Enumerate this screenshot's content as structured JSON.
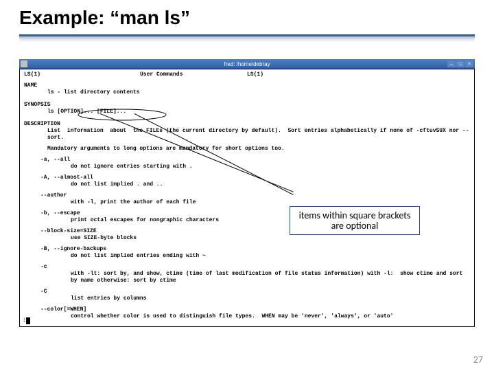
{
  "slide": {
    "title": "Example:  “man ls”",
    "page_number": "27"
  },
  "terminal": {
    "title": "fred: /home/debray",
    "header": {
      "left": "LS(1)",
      "center": "User Commands",
      "right": "LS(1)"
    },
    "sections": {
      "name": {
        "heading": "NAME",
        "line": "ls - list directory contents"
      },
      "synopsis": {
        "heading": "SYNOPSIS",
        "line": "ls [OPTION]... [FILE]..."
      },
      "description": {
        "heading": "DESCRIPTION",
        "para1": "List  information  about  the FILEs (the current directory by default).  Sort entries alphabetically if none of -cftuvSUX nor --sort.",
        "para2": "Mandatory arguments to long options are mandatory for short options too."
      },
      "options": [
        {
          "tag": "-a, --all",
          "desc": "do not ignore entries starting with ."
        },
        {
          "tag": "-A, --almost-all",
          "desc": "do not list implied . and .."
        },
        {
          "tag": "--author",
          "desc": "with -l, print the author of each file"
        },
        {
          "tag": "-b, --escape",
          "desc": "print octal escapes for nongraphic characters"
        },
        {
          "tag": "--block-size=SIZE",
          "desc": "use SIZE-byte blocks"
        },
        {
          "tag": "-B, --ignore-backups",
          "desc": "do not list implied entries ending with ~"
        },
        {
          "tag": "-c",
          "desc": "with -lt: sort by, and show, ctime (time of last modification of file status information) with -l:  show ctime and sort by name otherwise: sort by ctime"
        },
        {
          "tag": "-C",
          "desc": "list entries by columns"
        },
        {
          "tag": "--color[=WHEN]",
          "desc": "control whether color is used to distinguish file types.  WHEN may be 'never', 'always', or 'auto'"
        }
      ],
      "prompt": ":"
    },
    "window_controls": {
      "min": "–",
      "max": "□",
      "close": "×"
    }
  },
  "callout": {
    "text": "items within square brackets are optional"
  }
}
